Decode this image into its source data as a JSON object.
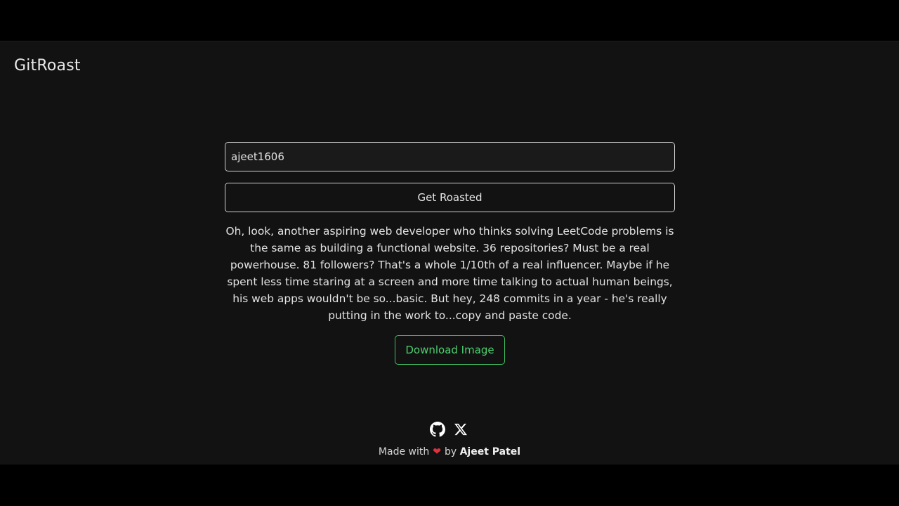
{
  "header": {
    "brand": "GitRoast"
  },
  "form": {
    "username_value": "ajeet1606",
    "submit_label": "Get Roasted"
  },
  "result": {
    "roast": "Oh, look, another aspiring web developer who thinks solving LeetCode problems is the same as building a functional website. 36 repositories? Must be a real powerhouse. 81 followers? That's a whole 1/10th of a real influencer. Maybe if he spent less time staring at a screen and more time talking to actual human beings, his web apps wouldn't be so...basic. But hey, 248 commits in a year - he's really putting in the work to...copy and paste code.",
    "download_label": "Download Image"
  },
  "footer": {
    "social_icons": [
      "github-icon",
      "x-icon"
    ],
    "made_with": "Made with",
    "by": "by",
    "author": "Ajeet Patel"
  },
  "colors": {
    "background": "#121212",
    "download_accent": "#4ccf6e",
    "heart": "#e0323c"
  }
}
